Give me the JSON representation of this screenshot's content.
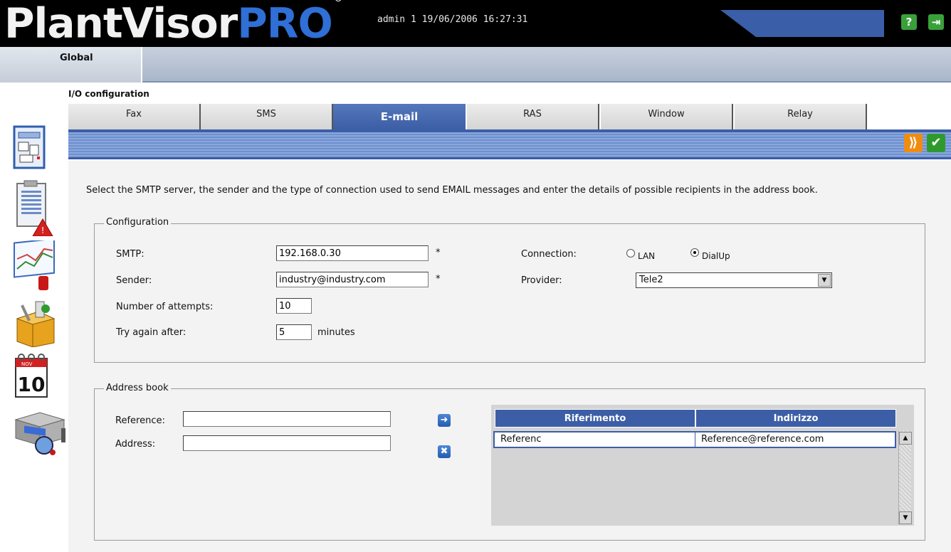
{
  "header": {
    "logo_part1": "PlantVisor",
    "logo_part2": "PRO",
    "logo_reg": "®",
    "user_info": "admin 1 19/06/2006 16:27:31",
    "help_icon": "?",
    "logout_icon": "⇥"
  },
  "nav": {
    "global_label": "Global"
  },
  "section_title": "I/O configuration",
  "tabs": [
    {
      "label": "Fax"
    },
    {
      "label": "SMS"
    },
    {
      "label": "E-mail"
    },
    {
      "label": "RAS"
    },
    {
      "label": "Window"
    },
    {
      "label": "Relay"
    }
  ],
  "active_tab": "E-mail",
  "toolbar": {
    "forward_icon": "⟫",
    "confirm_icon": "✔"
  },
  "description": "Select the SMTP server, the sender and the type of connection used to send EMAIL messages and enter the details of possible recipients in the address book.",
  "configuration": {
    "legend": "Configuration",
    "smtp_label": "SMTP:",
    "smtp_value": "192.168.0.30",
    "sender_label": "Sender:",
    "sender_value": "industry@industry.com",
    "required_mark": "*",
    "attempts_label": "Number of attempts:",
    "attempts_value": "10",
    "retry_label": "Try again after:",
    "retry_value": "5",
    "retry_unit": "minutes",
    "connection_label": "Connection:",
    "connection_options": [
      "LAN",
      "DialUp"
    ],
    "connection_selected": "DialUp",
    "provider_label": "Provider:",
    "provider_value": "Tele2"
  },
  "address_book": {
    "legend": "Address book",
    "reference_label": "Reference:",
    "reference_value": "",
    "address_label": "Address:",
    "address_value": "",
    "add_icon": "➜",
    "remove_icon": "✖",
    "columns": [
      "Riferimento",
      "Indirizzo"
    ],
    "rows": [
      {
        "riferimento": "Referenc",
        "indirizzo": "Reference@reference.com"
      }
    ]
  },
  "side_icons": [
    "layout-icon",
    "alarm-list-icon",
    "graph-icon",
    "tools-box-icon",
    "calendar-icon",
    "device-config-icon"
  ],
  "calendar": {
    "month": "NOV",
    "day": "10"
  },
  "colors": {
    "brand_blue": "#3c5ea6",
    "logo_blue": "#2f6fd6",
    "help_green": "#3aa03a"
  }
}
